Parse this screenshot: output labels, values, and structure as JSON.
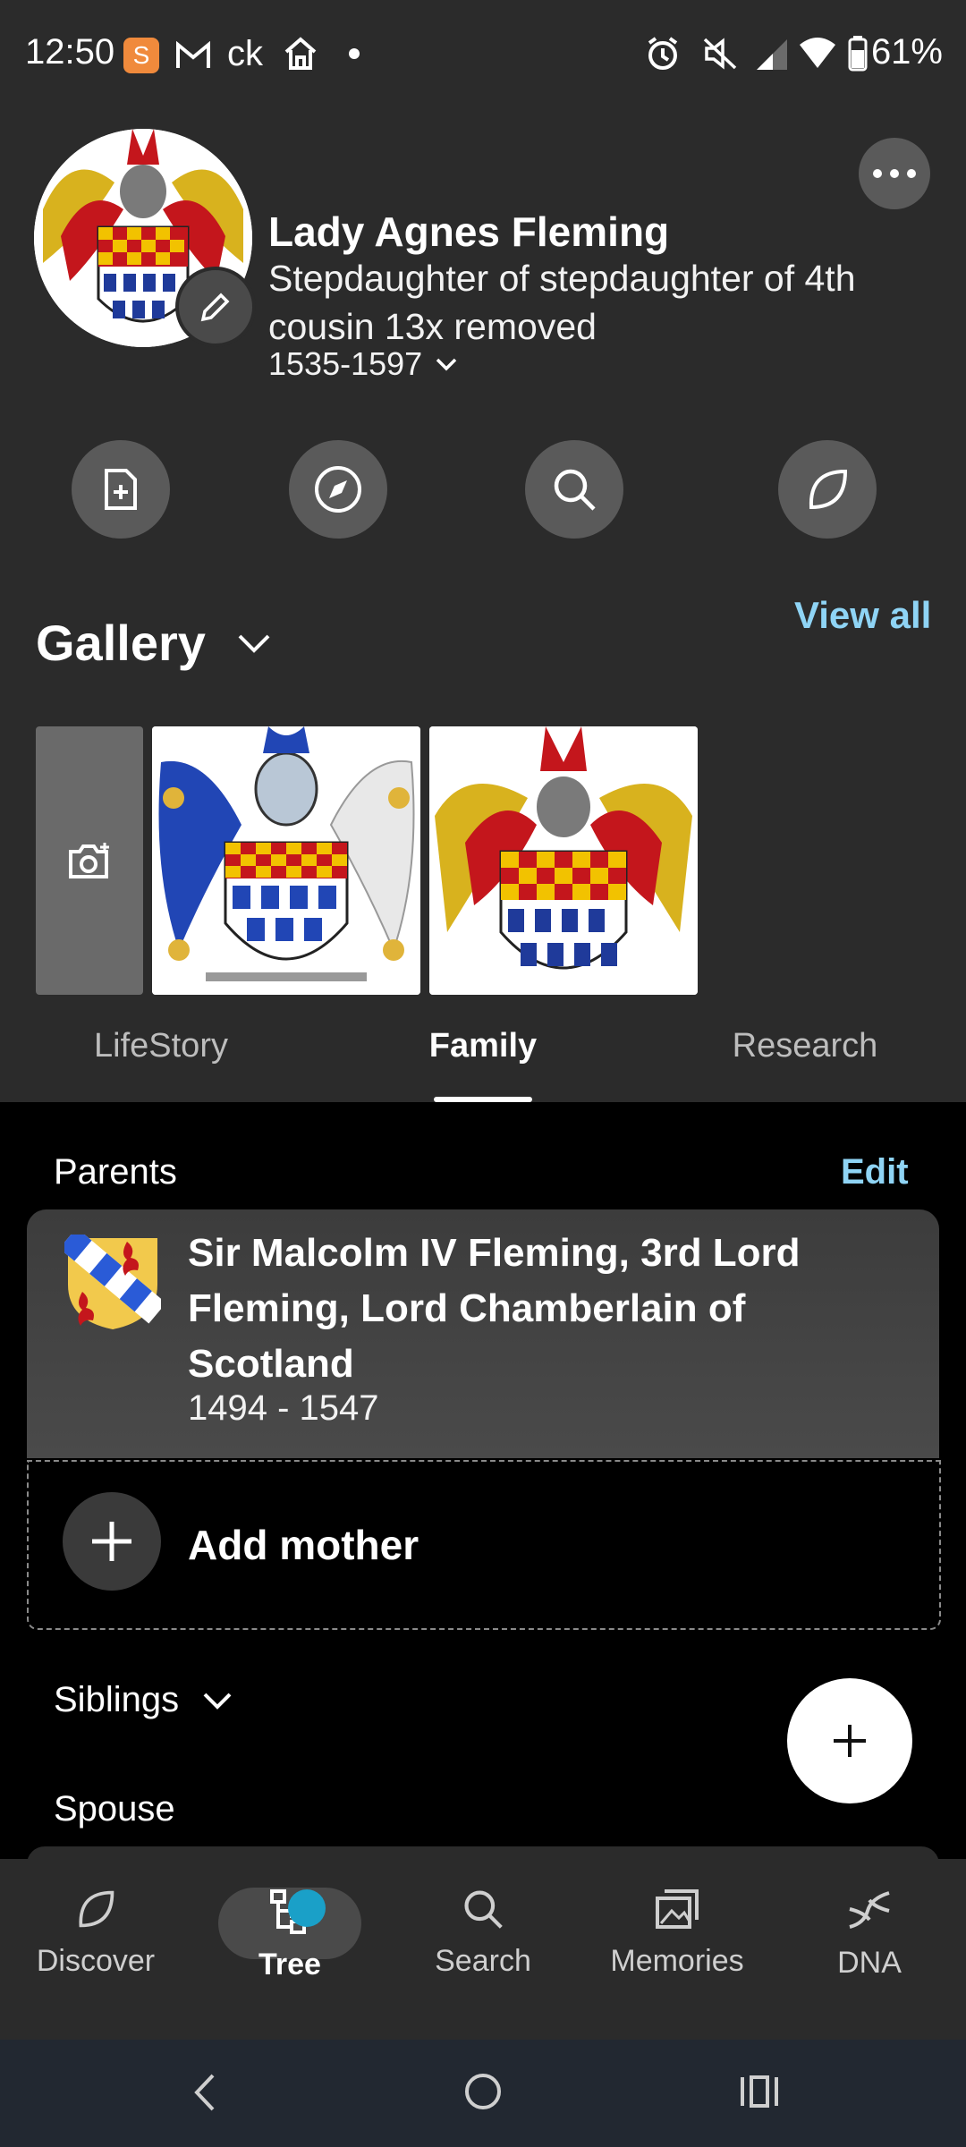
{
  "status_bar": {
    "time": "12:50",
    "notification_icons": [
      "s-app-icon",
      "gmail-icon",
      "ck-icon",
      "home-icon",
      "dot-icon"
    ],
    "ck_text": "ck",
    "battery": "61%",
    "system_icons": [
      "alarm-icon",
      "mute-icon",
      "signal-icon",
      "wifi-icon",
      "battery-icon"
    ]
  },
  "profile": {
    "name": "Lady Agnes Fleming",
    "relation": "Stepdaughter of stepdaughter of 4th cousin 13x removed",
    "dates": "1535-1597"
  },
  "actions": [
    "add-source-icon",
    "explore-icon",
    "search-icon",
    "hints-leaf-icon"
  ],
  "gallery": {
    "title": "Gallery",
    "view_all": "View all"
  },
  "tabs": [
    {
      "label": "LifeStory",
      "active": false
    },
    {
      "label": "Family",
      "active": true
    },
    {
      "label": "Research",
      "active": false
    }
  ],
  "family": {
    "parents_label": "Parents",
    "edit_label": "Edit",
    "father": {
      "name": "Sir Malcolm IV Fleming, 3rd Lord Fleming, Lord Chamberlain of Scotland",
      "dates": "1494 - 1547"
    },
    "add_mother_label": "Add mother",
    "siblings_label": "Siblings",
    "spouse_label": "Spouse"
  },
  "bottom_nav": [
    {
      "label": "Discover",
      "icon": "leaf-icon",
      "active": false
    },
    {
      "label": "Tree",
      "icon": "tree-icon",
      "active": true
    },
    {
      "label": "Search",
      "icon": "search-icon",
      "active": false
    },
    {
      "label": "Memories",
      "icon": "photos-icon",
      "active": false
    },
    {
      "label": "DNA",
      "icon": "dna-icon",
      "active": false
    }
  ],
  "colors": {
    "background": "#000000",
    "header": "#2b2b2b",
    "accent_link": "#8fd4f5",
    "badge": "#1aa0c8"
  }
}
